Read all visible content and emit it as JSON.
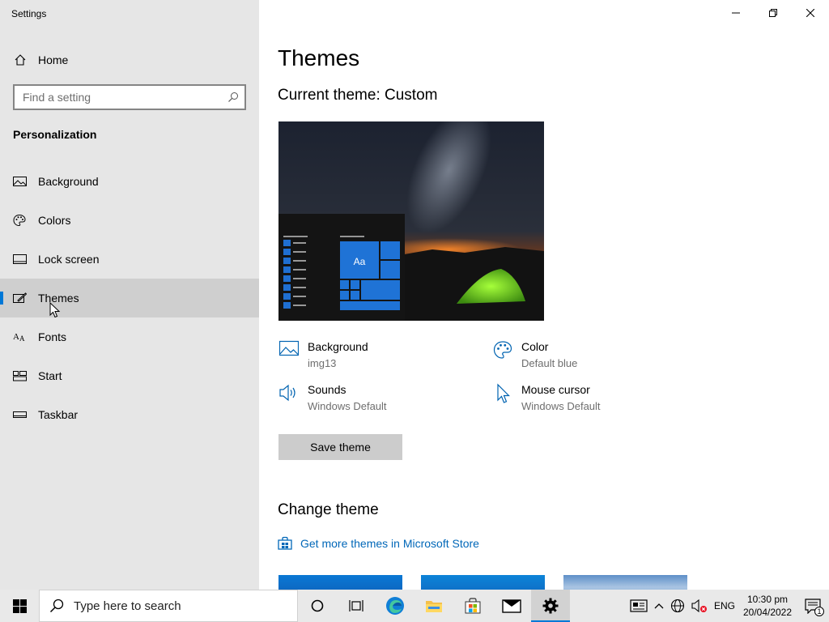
{
  "window": {
    "title": "Settings"
  },
  "sidebar": {
    "home_label": "Home",
    "search_placeholder": "Find a setting",
    "section_title": "Personalization",
    "items": [
      {
        "label": "Background",
        "icon": "picture-icon"
      },
      {
        "label": "Colors",
        "icon": "palette-icon"
      },
      {
        "label": "Lock screen",
        "icon": "lock-screen-icon"
      },
      {
        "label": "Themes",
        "icon": "themes-icon",
        "selected": true
      },
      {
        "label": "Fonts",
        "icon": "fonts-icon"
      },
      {
        "label": "Start",
        "icon": "start-icon"
      },
      {
        "label": "Taskbar",
        "icon": "taskbar-icon"
      }
    ]
  },
  "main": {
    "title": "Themes",
    "current_theme_label": "Current theme: Custom",
    "preview_tile_label": "Aa",
    "properties": {
      "background": {
        "label": "Background",
        "value": "img13"
      },
      "color": {
        "label": "Color",
        "value": "Default blue"
      },
      "sounds": {
        "label": "Sounds",
        "value": "Windows Default"
      },
      "mouse_cursor": {
        "label": "Mouse cursor",
        "value": "Windows Default"
      }
    },
    "save_button": "Save theme",
    "change_theme_title": "Change theme",
    "store_link": "Get more themes in Microsoft Store"
  },
  "taskbar": {
    "search_placeholder": "Type here to search",
    "language": "ENG",
    "time": "10:30 pm",
    "date": "20/04/2022",
    "notification_count": "1"
  },
  "colors": {
    "accent": "#0078d7",
    "link": "#0067b8",
    "sidebar_bg": "#e6e6e6"
  }
}
